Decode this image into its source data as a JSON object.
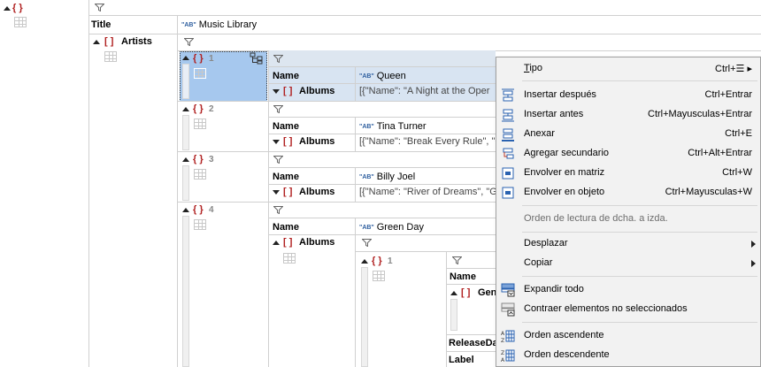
{
  "root": {
    "brace": "{ }"
  },
  "rows": {
    "title_label": "Title",
    "title_value": "Music Library",
    "artists_label": "Artists",
    "artists_brace": "[ ]"
  },
  "artists": [
    {
      "index": "1",
      "name_label": "Name",
      "name_value": "Queen",
      "albums_label": "Albums",
      "albums_value": "[{\"Name\": \"A Night at the Oper"
    },
    {
      "index": "2",
      "name_label": "Name",
      "name_value": "Tina Turner",
      "albums_label": "Albums",
      "albums_value": "[{\"Name\": \"Break Every Rule\", \"G"
    },
    {
      "index": "3",
      "name_label": "Name",
      "name_value": "Billy Joel",
      "albums_label": "Albums",
      "albums_value": "[{\"Name\": \"River of Dreams\", \"G"
    },
    {
      "index": "4",
      "name_label": "Name",
      "name_value": "Green Day",
      "albums_label": "Albums"
    }
  ],
  "nested": {
    "album_index": "1",
    "name_label": "Name",
    "genre_label": "Gen",
    "release_label": "ReleaseDa",
    "label_label": "Label"
  },
  "glyphs": {
    "obj": "{ }",
    "arr": "[ ]",
    "ab": "\"AB\""
  },
  "menu": {
    "items": [
      {
        "label": "Tipo",
        "accel": "T",
        "shortcut": "Ctrl+☰ ▸"
      },
      {
        "label": "Insertar después",
        "accel": "I",
        "shortcut": "Ctrl+Entrar"
      },
      {
        "label": "Insertar antes",
        "accel": "n",
        "shortcut": "Ctrl+Mayusculas+Entrar"
      },
      {
        "label": "Anexar",
        "accel": "A",
        "shortcut": "Ctrl+E"
      },
      {
        "label": "Agregar secundario",
        "accel": "A",
        "shortcut": "Ctrl+Alt+Entrar"
      },
      {
        "label": "Envolver en matriz",
        "accel": "v",
        "shortcut": "Ctrl+W"
      },
      {
        "label": "Envolver en objeto",
        "accel": "o",
        "shortcut": "Ctrl+Mayusculas+W"
      },
      {
        "label": "Orden de lectura de dcha. a izda."
      },
      {
        "label": "Desplazar"
      },
      {
        "label": "Copiar"
      },
      {
        "label": "Expandir todo",
        "accel": "E"
      },
      {
        "label": "Contraer elementos no seleccionados"
      },
      {
        "label": "Orden ascendente",
        "accel": "O"
      },
      {
        "label": "Orden descendente",
        "accel": "O"
      }
    ]
  }
}
